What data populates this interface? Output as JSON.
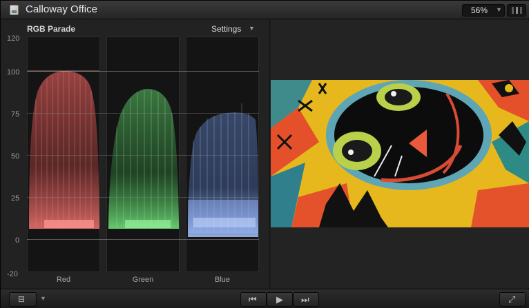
{
  "window": {
    "title": "Calloway Office",
    "zoom": "56%"
  },
  "scope": {
    "type_label": "RGB Parade",
    "settings_label": "Settings",
    "axis_ticks": [
      "120",
      "100",
      "75",
      "50",
      "25",
      "0",
      "-20"
    ],
    "channels": [
      {
        "name": "Red",
        "color": "#ff6a66"
      },
      {
        "name": "Green",
        "color": "#6ef07a"
      },
      {
        "name": "Blue",
        "color": "#7aa6ff"
      }
    ]
  },
  "viewer": {
    "image_subject": "cat-face-painting"
  },
  "icons": {
    "doc": "document-icon",
    "layout": "layout-icon",
    "prev": "skip-back-icon",
    "play": "play-icon",
    "next": "skip-forward-icon",
    "fullscreen": "fullscreen-icon"
  }
}
